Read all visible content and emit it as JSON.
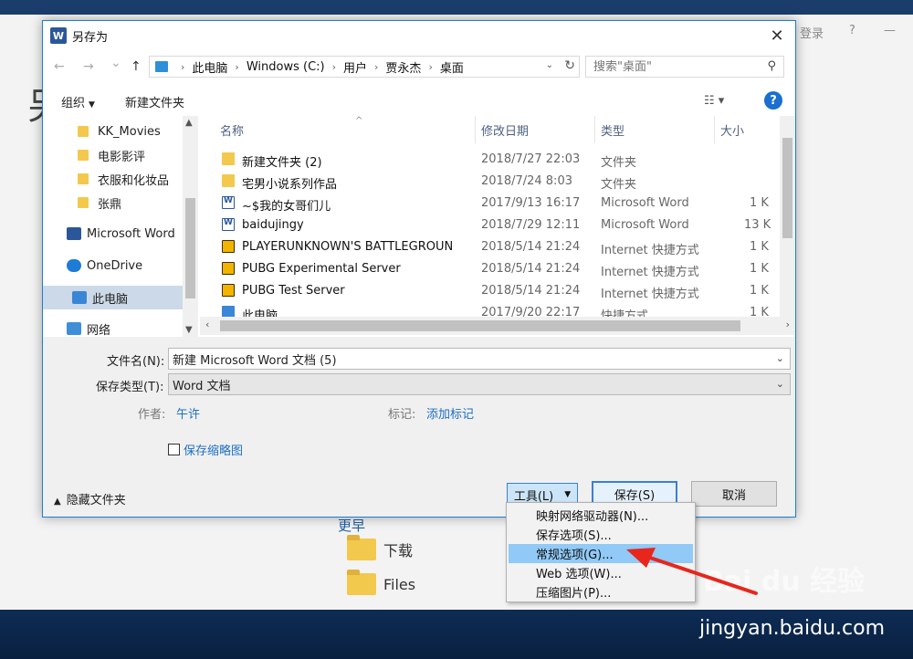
{
  "background": {
    "login": "登录",
    "help": "?",
    "minimize": "—",
    "big_char": "另",
    "recent": "更早",
    "recent_items": [
      {
        "label": "下载"
      },
      {
        "label": "Files"
      }
    ],
    "watermark": "Bai du 经验",
    "watermark_url": "jingyan.baidu.com"
  },
  "dialog": {
    "title": "另存为",
    "word_icon": "W",
    "close": "✕",
    "nav": {
      "back": "←",
      "forward": "→",
      "recent": "⌄",
      "up": "↑"
    },
    "breadcrumb": [
      "此电脑",
      "Windows (C:)",
      "用户",
      "贾永杰",
      "桌面"
    ],
    "search_placeholder": "搜索\"桌面\"",
    "toolbar": {
      "organize": "组织",
      "new_folder": "新建文件夹",
      "help": "?"
    },
    "nav_pane": [
      {
        "label": "KK_Movies",
        "icon": "folder-icon"
      },
      {
        "label": "电影影评",
        "icon": "folder-icon"
      },
      {
        "label": "衣服和化妆品",
        "icon": "folder-icon"
      },
      {
        "label": "张鼎",
        "icon": "folder-icon"
      },
      {
        "label": "Microsoft Word",
        "icon": "word-icon"
      },
      {
        "label": "OneDrive",
        "icon": "cloud-icon"
      },
      {
        "label": "此电脑",
        "icon": "computer-icon"
      },
      {
        "label": "网络",
        "icon": "network-icon"
      }
    ],
    "columns": {
      "name": "名称",
      "date": "修改日期",
      "type": "类型",
      "size": "大小"
    },
    "files": [
      {
        "name": "新建文件夹 (2)",
        "date": "2018/7/27 22:03",
        "type": "文件夹",
        "size": "",
        "icon": "folder"
      },
      {
        "name": "宅男小说系列作品",
        "date": "2018/7/24 8:03",
        "type": "文件夹",
        "size": "",
        "icon": "folder"
      },
      {
        "name": "~$我的女哥们儿",
        "date": "2017/9/13 16:17",
        "type": "Microsoft Word",
        "size": "1 K",
        "icon": "word"
      },
      {
        "name": "baidujingy",
        "date": "2018/7/29 12:11",
        "type": "Microsoft Word",
        "size": "13 K",
        "icon": "word"
      },
      {
        "name": "PLAYERUNKNOWN'S BATTLEGROUN",
        "date": "2018/5/14 21:24",
        "type": "Internet 快捷方式",
        "size": "1 K",
        "icon": "pubg"
      },
      {
        "name": "PUBG Experimental Server",
        "date": "2018/5/14 21:24",
        "type": "Internet 快捷方式",
        "size": "1 K",
        "icon": "pubg"
      },
      {
        "name": "PUBG Test Server",
        "date": "2018/5/14 21:24",
        "type": "Internet 快捷方式",
        "size": "1 K",
        "icon": "pubg"
      },
      {
        "name": "此电脑",
        "date": "2017/9/20 22:17",
        "type": "快捷方式",
        "size": "1 K",
        "icon": "pc"
      }
    ],
    "filename_label": "文件名(N):",
    "filename_value": "新建 Microsoft Word 文档 (5)",
    "filetype_label": "保存类型(T):",
    "filetype_value": "Word 文档",
    "author_label": "作者:",
    "author_value": "午许",
    "tags_label": "标记:",
    "tags_value": "添加标记",
    "thumbnail_label": "保存缩略图",
    "hide_folders": "隐藏文件夹",
    "tools_btn": "工具(L)",
    "save_btn": "保存(S)",
    "cancel_btn": "取消"
  },
  "tools_menu": [
    {
      "label": "映射网络驱动器(N)..."
    },
    {
      "label": "保存选项(S)..."
    },
    {
      "label": "常规选项(G)...",
      "highlighted": true
    },
    {
      "label": "Web 选项(W)..."
    },
    {
      "label": "压缩图片(P)..."
    }
  ],
  "colors": {
    "accent": "#1a7fd4",
    "highlight": "#91c9f7",
    "arrow": "#e8261c"
  }
}
